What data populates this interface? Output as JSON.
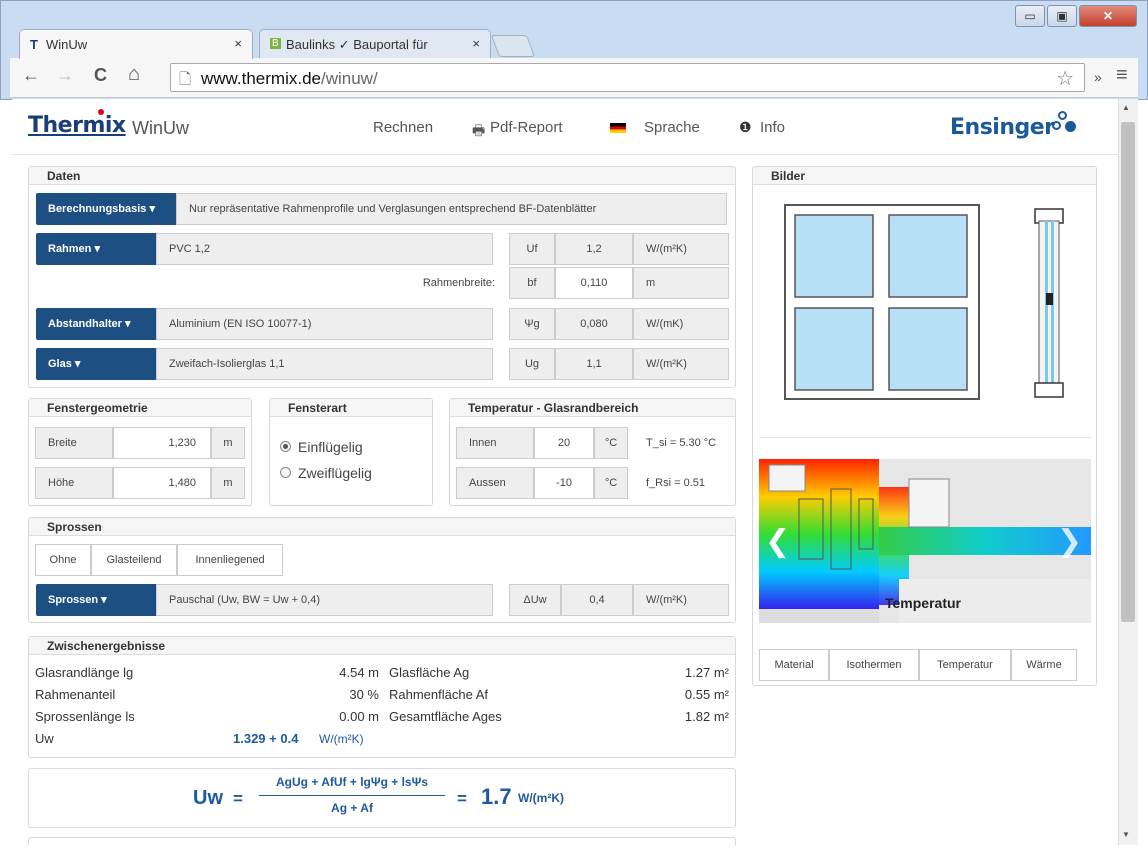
{
  "browser": {
    "tabs": [
      {
        "icon": "T",
        "title": "WinUw",
        "close": "×"
      },
      {
        "icon": "B",
        "title": "Baulinks ✓ Bauportal für",
        "close": "×"
      }
    ],
    "window_buttons": {
      "minimize": "▭",
      "maximize": "▣",
      "close": "✕"
    },
    "nav": {
      "back": "←",
      "forward": "→",
      "reload": "C",
      "home": "⌂"
    },
    "url_host": "www.thermix.de",
    "url_path": "/winuw/",
    "star": "☆",
    "ext": "»",
    "menu": "≡"
  },
  "header": {
    "logo": "Thermix",
    "app": "WinUw",
    "menu": {
      "rechnen": "Rechnen",
      "pdf_icon": "🖶",
      "pdf": "Pdf-Report",
      "sprache": "Sprache",
      "info_icon": "❶",
      "info": "Info"
    },
    "brand": "Ensinger"
  },
  "daten": {
    "title": "Daten",
    "berechnungsbasis": {
      "label": "Berechnungsbasis ▾",
      "value": "Nur repräsentative Rahmenprofile und Verglasungen entsprechend BF-Datenblätter"
    },
    "rahmen": {
      "label": "Rahmen ▾",
      "value": "PVC 1,2",
      "sym": "Uf",
      "num": "1,2",
      "unit": "W/(m²K)"
    },
    "rahmenbreite": {
      "label": "Rahmenbreite:",
      "sym": "bf",
      "num": "0,110",
      "unit": "m"
    },
    "abstandhalter": {
      "label": "Abstandhalter ▾",
      "value": "Aluminium (EN ISO 10077-1)",
      "sym": "Ψg",
      "num": "0,080",
      "unit": "W/(mK)"
    },
    "glas": {
      "label": "Glas ▾",
      "value": "Zweifach-Isolierglas 1,1",
      "sym": "Ug",
      "num": "1,1",
      "unit": "W/(m²K)"
    }
  },
  "fenstergeometrie": {
    "title": "Fenstergeometrie",
    "breite": {
      "label": "Breite",
      "value": "1,230",
      "unit": "m"
    },
    "hoehe": {
      "label": "Höhe",
      "value": "1,480",
      "unit": "m"
    }
  },
  "fensterart": {
    "title": "Fensterart",
    "options": [
      "Einflügelig",
      "Zweiflügelig"
    ],
    "selected": "Einflügelig"
  },
  "temperatur": {
    "title": "Temperatur - Glasrandbereich",
    "innen": {
      "label": "Innen",
      "value": "20",
      "unit": "°C",
      "result": "T_si = 5.30 °C"
    },
    "aussen": {
      "label": "Aussen",
      "value": "-10",
      "unit": "°C",
      "result": "f_Rsi = 0.51"
    }
  },
  "sprossen": {
    "title": "Sprossen",
    "buttons": [
      "Ohne",
      "Glasteilend",
      "Innenliegened"
    ],
    "select": {
      "label": "Sprossen ▾",
      "value": "Pauschal (Uw, BW = Uw + 0,4)",
      "sym": "ΔUw",
      "num": "0,4",
      "unit": "W/(m²K)"
    }
  },
  "zwischen": {
    "title": "Zwischenergebnisse",
    "rows": [
      {
        "l1": "Glasrandlänge lg",
        "v1": "4.54 m",
        "l2": "Glasfläche Ag",
        "v2": "1.27 m²"
      },
      {
        "l1": "Rahmenanteil",
        "v1": "30 %",
        "l2": "Rahmenfläche Af",
        "v2": "0.55 m²"
      },
      {
        "l1": "Sprossenlänge ls",
        "v1": "0.00 m",
        "l2": "Gesamtfläche Ages",
        "v2": "1.82 m²"
      }
    ],
    "uw_label": "Uw",
    "uw_value": "1.329 + 0.4",
    "uw_unit": "W/(m²K)"
  },
  "formula": {
    "lhs": "Uw",
    "eq": "=",
    "numerator": "AgUg + AfUf + lgΨg + lsΨs",
    "denominator": "Ag + Af",
    "eq2": "=",
    "result": "1.7",
    "unit": "W/(m²K)"
  },
  "bilder": {
    "title": "Bilder",
    "caption": "Temperatur",
    "prev": "❮",
    "next": "❯",
    "tabs": [
      "Material",
      "Isothermen",
      "Temperatur",
      "Wärme"
    ]
  },
  "colors": {
    "primary": "#1e4f82",
    "accent": "#1a5a98",
    "uw": "#1e5aa0",
    "glass": "#b7dff5"
  }
}
